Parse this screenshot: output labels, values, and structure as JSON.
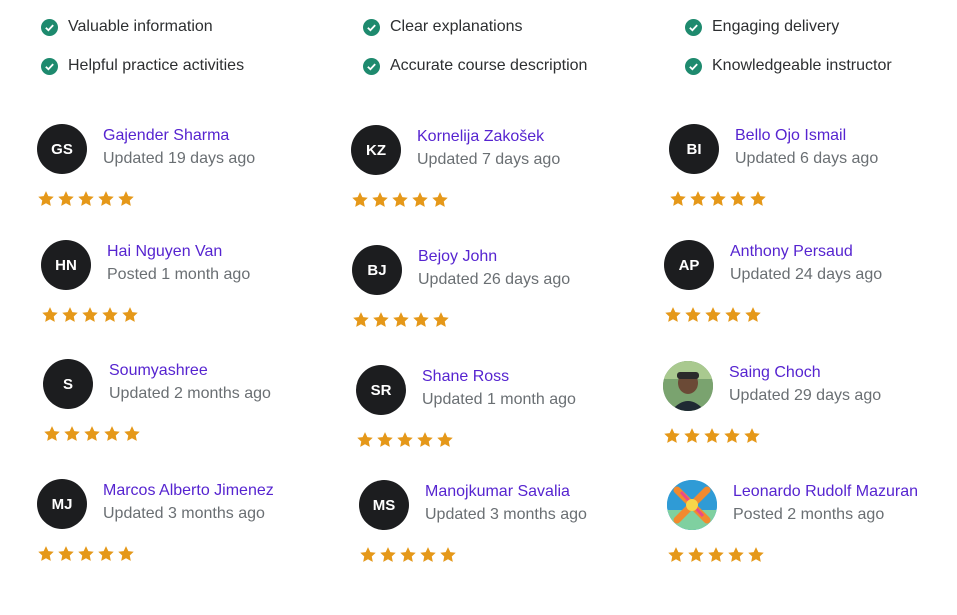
{
  "highlights": [
    {
      "label": "Valuable information"
    },
    {
      "label": "Clear explanations"
    },
    {
      "label": "Engaging delivery"
    },
    {
      "label": "Helpful practice activities"
    },
    {
      "label": "Accurate course description"
    },
    {
      "label": "Knowledgeable instructor"
    }
  ],
  "colors": {
    "check": "#1e8a6e",
    "name": "#5624d0",
    "meta": "#6a6f73",
    "star": "#e59819",
    "avatar_bg": "#1c1d1f"
  },
  "reviews": [
    {
      "initials": "GS",
      "name": "Gajender Sharma",
      "meta": "Updated 19 days ago",
      "rating": 5
    },
    {
      "initials": "KZ",
      "name": "Kornelija Zakošek",
      "meta": "Updated 7 days ago",
      "rating": 5
    },
    {
      "initials": "BI",
      "name": "Bello Ojo Ismail",
      "meta": "Updated 6 days ago",
      "rating": 5
    },
    {
      "initials": "HN",
      "name": "Hai Nguyen Van",
      "meta": "Posted 1 month ago",
      "rating": 5
    },
    {
      "initials": "BJ",
      "name": "Bejoy John",
      "meta": "Updated 26 days ago",
      "rating": 5
    },
    {
      "initials": "AP",
      "name": "Anthony Persaud",
      "meta": "Updated 24 days ago",
      "rating": 5
    },
    {
      "initials": "S",
      "name": "Soumyashree",
      "meta": "Updated 2 months ago",
      "rating": 5
    },
    {
      "initials": "SR",
      "name": "Shane Ross",
      "meta": "Updated 1 month ago",
      "rating": 5
    },
    {
      "initials": "",
      "avatar_image": "person-photo",
      "name": "Saing Choch",
      "meta": "Updated 29 days ago",
      "rating": 5
    },
    {
      "initials": "MJ",
      "name": "Marcos Alberto Jimenez",
      "meta": "Updated 3 months ago",
      "rating": 5
    },
    {
      "initials": "MS",
      "name": "Manojkumar Savalia",
      "meta": "Updated 3 months ago",
      "rating": 5
    },
    {
      "initials": "",
      "avatar_image": "colorful-logo",
      "name": "Leonardo Rudolf Mazuran",
      "meta": "Posted 2 months ago",
      "rating": 5
    }
  ]
}
